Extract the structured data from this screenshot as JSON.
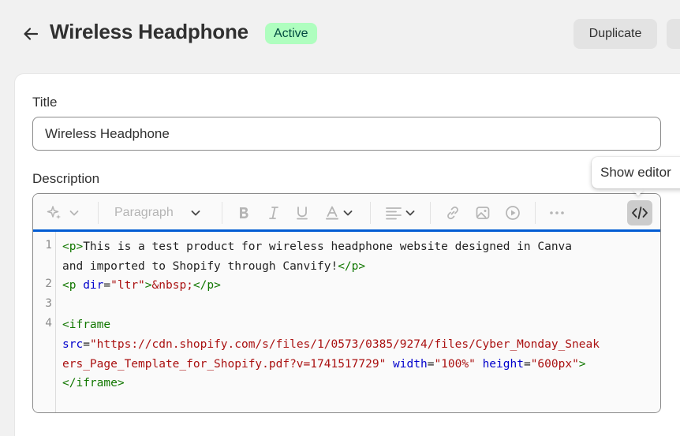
{
  "header": {
    "title": "Wireless Headphone",
    "status": "Active",
    "duplicate_label": "Duplicate"
  },
  "form": {
    "title_label": "Title",
    "title_value": "Wireless Headphone",
    "description_label": "Description"
  },
  "toolbar": {
    "paragraph_label": "Paragraph",
    "tooltip": "Show editor"
  },
  "code": {
    "line_numbers": [
      "1",
      "2",
      "3",
      "4"
    ]
  },
  "colors": {
    "active_badge_bg": "#affebf",
    "active_badge_text": "#014b40",
    "focus_border": "#005bd3"
  }
}
